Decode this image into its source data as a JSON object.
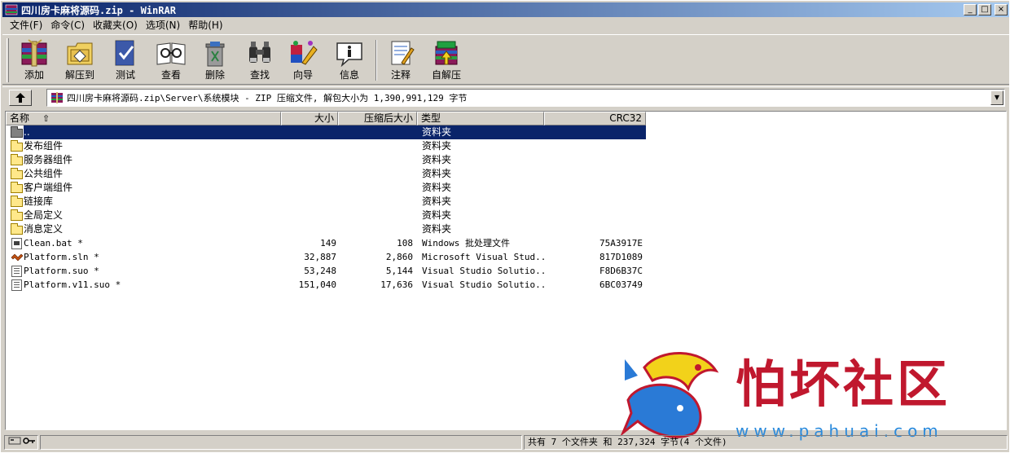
{
  "window": {
    "title": "四川房卡麻将源码.zip - WinRAR",
    "buttons": {
      "minimize": "_",
      "maximize": "□",
      "close": "×"
    }
  },
  "menu": [
    "文件(F)",
    "命令(C)",
    "收藏夹(O)",
    "选项(N)",
    "帮助(H)"
  ],
  "toolbar": [
    {
      "label": "添加",
      "icon": "add-archive-icon"
    },
    {
      "label": "解压到",
      "icon": "extract-to-icon"
    },
    {
      "label": "测试",
      "icon": "test-icon"
    },
    {
      "label": "查看",
      "icon": "view-icon"
    },
    {
      "label": "删除",
      "icon": "delete-icon"
    },
    {
      "label": "查找",
      "icon": "find-icon"
    },
    {
      "label": "向导",
      "icon": "wizard-icon"
    },
    {
      "label": "信息",
      "icon": "info-icon"
    },
    {
      "label": "注释",
      "icon": "comment-icon"
    },
    {
      "label": "自解压",
      "icon": "sfx-icon"
    }
  ],
  "address": {
    "path": "四川房卡麻将源码.zip\\Server\\系统模块 - ZIP 压缩文件, 解包大小为 1,390,991,129 字节"
  },
  "columns": {
    "name": "名称",
    "size": "大小",
    "packed": "压缩后大小",
    "type": "类型",
    "crc": "CRC32"
  },
  "rows": [
    {
      "name": "..",
      "size": "",
      "packed": "",
      "type": "资料夹",
      "crc": "",
      "icon": "parent-folder",
      "selected": true
    },
    {
      "name": "发布组件",
      "size": "",
      "packed": "",
      "type": "资料夹",
      "crc": "",
      "icon": "folder"
    },
    {
      "name": "服务器组件",
      "size": "",
      "packed": "",
      "type": "资料夹",
      "crc": "",
      "icon": "folder"
    },
    {
      "name": "公共组件",
      "size": "",
      "packed": "",
      "type": "资料夹",
      "crc": "",
      "icon": "folder"
    },
    {
      "name": "客户端组件",
      "size": "",
      "packed": "",
      "type": "资料夹",
      "crc": "",
      "icon": "folder"
    },
    {
      "name": "链接库",
      "size": "",
      "packed": "",
      "type": "资料夹",
      "crc": "",
      "icon": "folder"
    },
    {
      "name": "全局定义",
      "size": "",
      "packed": "",
      "type": "资料夹",
      "crc": "",
      "icon": "folder"
    },
    {
      "name": "消息定义",
      "size": "",
      "packed": "",
      "type": "资料夹",
      "crc": "",
      "icon": "folder"
    },
    {
      "name": "Clean.bat *",
      "size": "149",
      "packed": "108",
      "type": "Windows 批处理文件",
      "crc": "75A3917E",
      "icon": "bat"
    },
    {
      "name": "Platform.sln *",
      "size": "32,887",
      "packed": "2,860",
      "type": "Microsoft Visual Stud...",
      "crc": "817D1089",
      "icon": "sln"
    },
    {
      "name": "Platform.suo *",
      "size": "53,248",
      "packed": "5,144",
      "type": "Visual Studio Solutio...",
      "crc": "F8D6B37C",
      "icon": "suo"
    },
    {
      "name": "Platform.v11.suo *",
      "size": "151,040",
      "packed": "17,636",
      "type": "Visual Studio Solutio...",
      "crc": "6BC03749",
      "icon": "suo"
    }
  ],
  "status": {
    "summary": "共有 7 个文件夹 和 237,324 字节(4 个文件)"
  },
  "watermark": {
    "text": "怕坏社区",
    "url": "www.pahuai.com"
  }
}
